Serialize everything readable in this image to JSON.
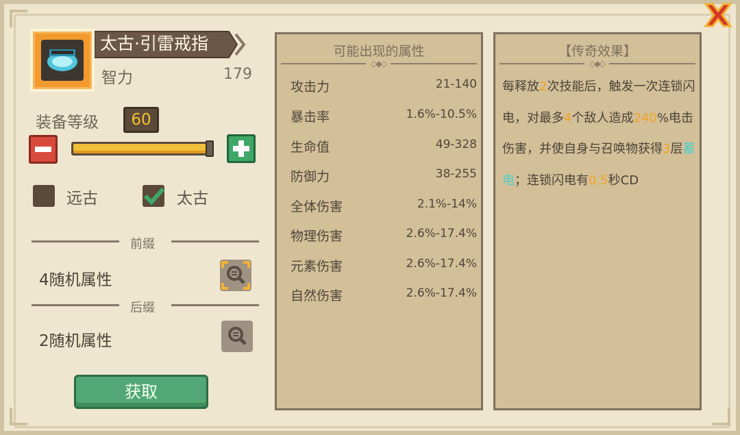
{
  "item": {
    "name": "太古·引雷戒指",
    "attribute_label": "智力",
    "attribute_value": "179",
    "icon": "ring-icon"
  },
  "level": {
    "label": "装备等级",
    "value": "60",
    "progress": 0.97
  },
  "quality": [
    {
      "label": "远古",
      "checked": false
    },
    {
      "label": "太古",
      "checked": true
    }
  ],
  "prefix": {
    "title": "前缀",
    "text": "4随机属性"
  },
  "suffix": {
    "title": "后缀",
    "text": "2随机属性"
  },
  "acquire_button": "获取",
  "possible_stats": {
    "title": "可能出现的属性",
    "rows": [
      {
        "name": "攻击力",
        "value": "21-140"
      },
      {
        "name": "暴击率",
        "value": "1.6%-10.5%"
      },
      {
        "name": "生命值",
        "value": "49-328"
      },
      {
        "name": "防御力",
        "value": "38-255"
      },
      {
        "name": "全体伤害",
        "value": "2.1%-14%"
      },
      {
        "name": "物理伤害",
        "value": "2.6%-17.4%"
      },
      {
        "name": "元素伤害",
        "value": "2.6%-17.4%"
      },
      {
        "name": "自然伤害",
        "value": "2.6%-17.4%"
      }
    ]
  },
  "legend": {
    "title": "【传奇效果】",
    "segments": [
      {
        "text": "每释放",
        "style": "normal"
      },
      {
        "text": "2",
        "style": "orange"
      },
      {
        "text": "次技能后，触发一次连锁闪电，对最多",
        "style": "normal"
      },
      {
        "text": "4",
        "style": "orange"
      },
      {
        "text": "个敌人造成",
        "style": "normal"
      },
      {
        "text": "240",
        "style": "orange"
      },
      {
        "text": "%电击伤害，并使自身与召唤物获得",
        "style": "normal"
      },
      {
        "text": "3",
        "style": "orange"
      },
      {
        "text": "层",
        "style": "normal"
      },
      {
        "text": "蓄电",
        "style": "cyan"
      },
      {
        "text": "；连锁闪电有",
        "style": "normal"
      },
      {
        "text": "0.5",
        "style": "orange"
      },
      {
        "text": "秒CD",
        "style": "normal"
      }
    ]
  },
  "colors": {
    "orange_highlight": "#f1a524",
    "cyan_highlight": "#4fd1c9",
    "item_frame": "#f29a2e"
  }
}
